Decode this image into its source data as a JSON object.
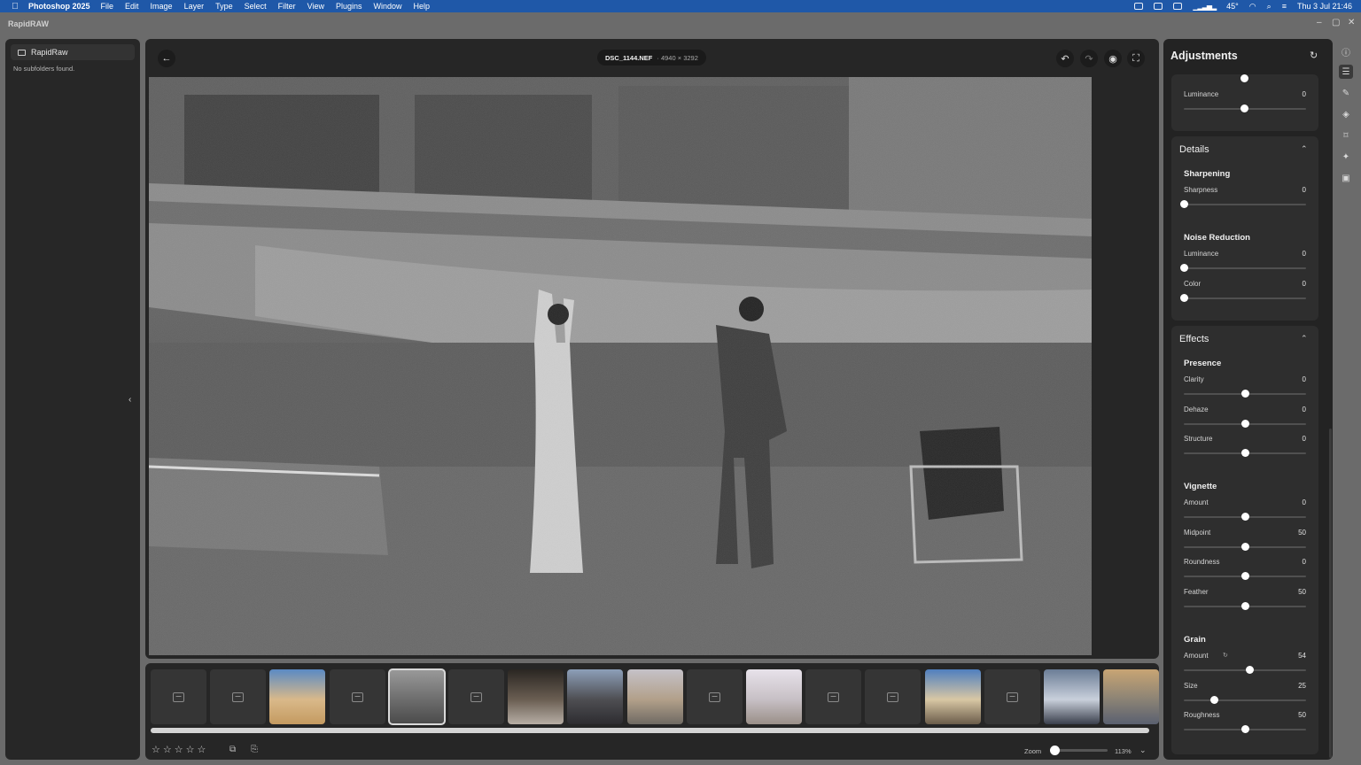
{
  "menubar": {
    "app_name": "Photoshop 2025",
    "items": [
      "File",
      "Edit",
      "Image",
      "Layer",
      "Type",
      "Select",
      "Filter",
      "View",
      "Plugins",
      "Window",
      "Help"
    ],
    "temperature": "45°",
    "clock": "Thu 3 Jul  21:46"
  },
  "window": {
    "title": "RapidRAW"
  },
  "folders": {
    "root": "RapidRaw",
    "empty_message": "No subfolders found."
  },
  "viewer": {
    "filename": "DSC_1144.NEF",
    "dimensions": "· 4940 × 3292"
  },
  "filmstrip": {
    "thumbs": [
      {
        "kind": "placeholder"
      },
      {
        "kind": "placeholder"
      },
      {
        "kind": "image",
        "colors": [
          "#5a8ac4",
          "#d9b98a",
          "#c49a60"
        ]
      },
      {
        "kind": "placeholder"
      },
      {
        "kind": "image",
        "selected": true,
        "colors": [
          "#9a9a9a",
          "#6d6d6d",
          "#4a4a4a"
        ]
      },
      {
        "kind": "placeholder"
      },
      {
        "kind": "image",
        "colors": [
          "#2a2622",
          "#6a5e52",
          "#b7aea5"
        ]
      },
      {
        "kind": "image",
        "colors": [
          "#8d9fb8",
          "#4e4e52",
          "#2d2c30"
        ]
      },
      {
        "kind": "image",
        "colors": [
          "#c5c2c8",
          "#b2a08a",
          "#6f6a63"
        ]
      },
      {
        "kind": "placeholder"
      },
      {
        "kind": "image",
        "colors": [
          "#e7e2ea",
          "#c7c0c5",
          "#9a8f88"
        ]
      },
      {
        "kind": "placeholder"
      },
      {
        "kind": "placeholder"
      },
      {
        "kind": "image",
        "colors": [
          "#4f7fbf",
          "#d8c7a4",
          "#6a5c4a"
        ]
      },
      {
        "kind": "placeholder"
      },
      {
        "kind": "image",
        "colors": [
          "#6b7d96",
          "#c9d0db",
          "#3a3f4c"
        ]
      },
      {
        "kind": "image",
        "colors": [
          "#c8a574",
          "#8b8375",
          "#5a6070"
        ]
      }
    ],
    "rating_stars": 0,
    "zoom_label": "Zoom",
    "zoom_value": "113%"
  },
  "adjustments": {
    "title": "Adjustments",
    "top_partial": {
      "slider_label": "Luminance",
      "value": "0",
      "position": 0.5
    },
    "details": {
      "title": "Details",
      "sharpening": {
        "title": "Sharpening",
        "sliders": [
          {
            "label": "Sharpness",
            "value": "0",
            "position": 0.0
          }
        ]
      },
      "noise_reduction": {
        "title": "Noise Reduction",
        "sliders": [
          {
            "label": "Luminance",
            "value": "0",
            "position": 0.0
          },
          {
            "label": "Color",
            "value": "0",
            "position": 0.0
          }
        ]
      }
    },
    "effects": {
      "title": "Effects",
      "presence": {
        "title": "Presence",
        "sliders": [
          {
            "label": "Clarity",
            "value": "0",
            "position": 0.5
          },
          {
            "label": "Dehaze",
            "value": "0",
            "position": 0.5
          },
          {
            "label": "Structure",
            "value": "0",
            "position": 0.5
          }
        ]
      },
      "vignette": {
        "title": "Vignette",
        "sliders": [
          {
            "label": "Amount",
            "value": "0",
            "position": 0.5
          },
          {
            "label": "Midpoint",
            "value": "50",
            "position": 0.5
          },
          {
            "label": "Roundness",
            "value": "0",
            "position": 0.5
          },
          {
            "label": "Feather",
            "value": "50",
            "position": 0.5
          }
        ]
      },
      "grain": {
        "title": "Grain",
        "sliders": [
          {
            "label": "Amount",
            "value": "54",
            "position": 0.54
          },
          {
            "label": "Size",
            "value": "25",
            "position": 0.25
          },
          {
            "label": "Roughness",
            "value": "50",
            "position": 0.5
          }
        ]
      }
    }
  },
  "rail_icons": [
    "info-icon",
    "sliders-icon",
    "edit-icon",
    "layers-icon",
    "bookmark-icon",
    "sparkle-icon",
    "save-icon"
  ]
}
